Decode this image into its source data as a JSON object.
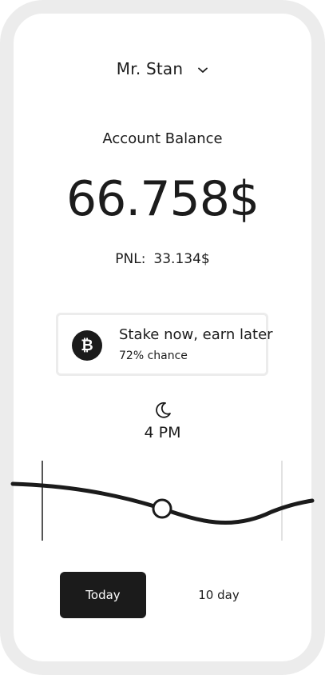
{
  "account": {
    "name": "Mr. Stan",
    "chevron_icon": "chevron-down-icon"
  },
  "balance": {
    "label": "Account Balance",
    "value": "66.758$"
  },
  "pnl": {
    "label": "PNL:",
    "value": "33.134$"
  },
  "stake_card": {
    "icon": "bitcoin-icon",
    "title": "Stake now, earn later",
    "subtitle": "72% chance"
  },
  "time": {
    "icon": "moon-icon",
    "label": "4 PM"
  },
  "range_tabs": {
    "today": "Today",
    "ten_day": "10 day",
    "selected": "Today"
  },
  "colors": {
    "frame": "#ececec",
    "ink": "#1b1b1b",
    "background": "#ffffff"
  }
}
